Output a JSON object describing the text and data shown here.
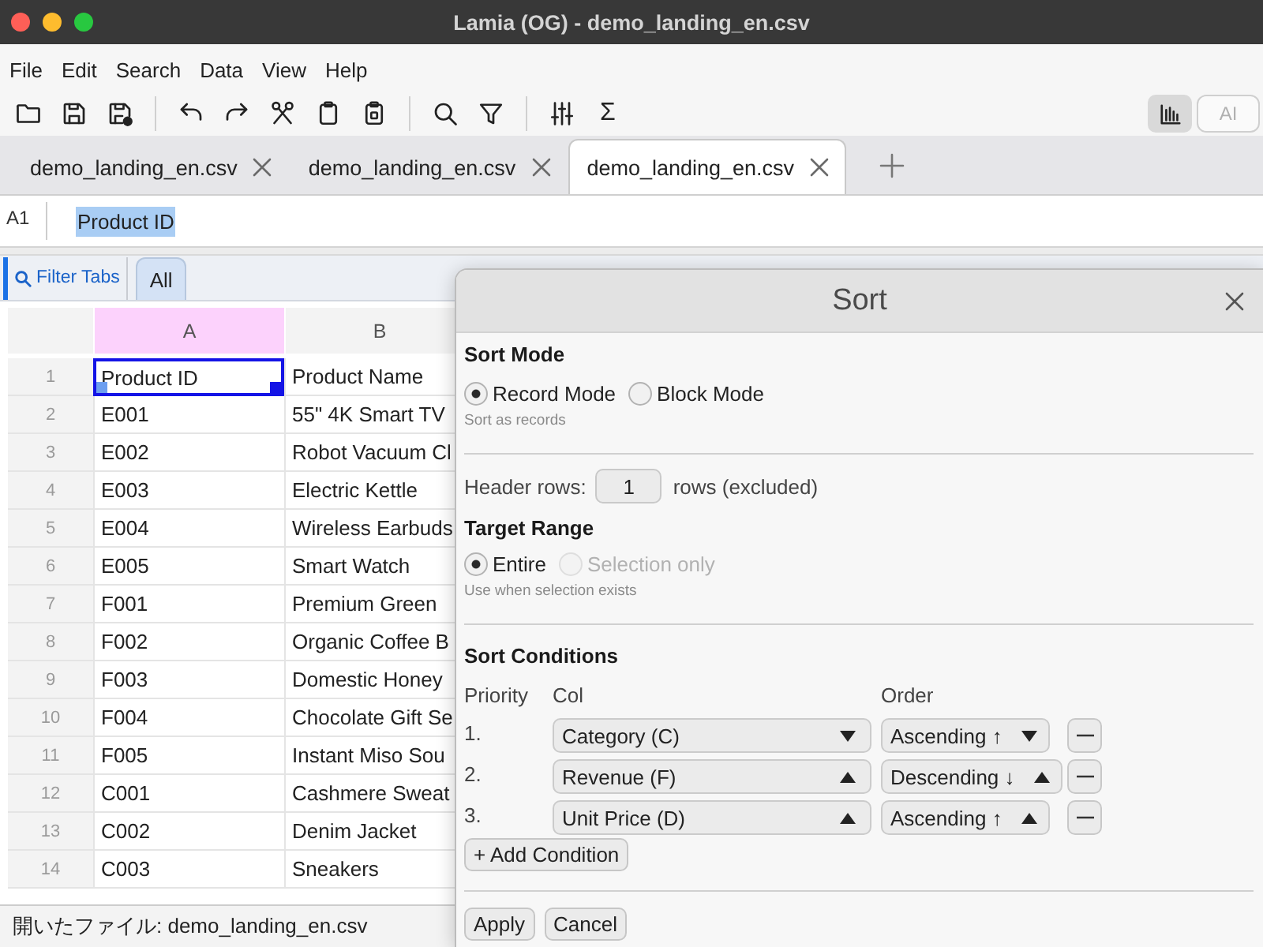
{
  "window": {
    "title": "Lamia (OG) - demo_landing_en.csv"
  },
  "menu": [
    "File",
    "Edit",
    "Search",
    "Data",
    "View",
    "Help"
  ],
  "toolbar": {
    "sum": "Σ",
    "chart_toggle": {
      "on": true
    },
    "ai_button": {
      "label": "AI",
      "disabled": true
    }
  },
  "tabs": [
    {
      "label": "demo_landing_en.csv",
      "selected": false
    },
    {
      "label": "demo_landing_en.csv",
      "selected": false
    },
    {
      "label": "demo_landing_en.csv",
      "selected": true
    }
  ],
  "formula_bar": {
    "cell_ref": "A1",
    "value": "Product ID",
    "value_selected": true
  },
  "sheet_tabs": {
    "filter": "Filter Tabs",
    "tabs": [
      {
        "label": "All",
        "selected": true
      }
    ]
  },
  "grid": {
    "columns": [
      {
        "label": "A",
        "selected": true
      },
      {
        "label": "B",
        "selected": false
      }
    ],
    "rows": [
      {
        "number": "1",
        "cells": [
          {
            "text": "Product ID",
            "selected": true
          },
          {
            "text": "Product Name",
            "selected": false
          }
        ]
      },
      {
        "number": "2",
        "cells": [
          {
            "text": "E001",
            "selected": false
          },
          {
            "text": "55\" 4K Smart TV",
            "selected": false
          }
        ]
      },
      {
        "number": "3",
        "cells": [
          {
            "text": "E002",
            "selected": false
          },
          {
            "text": "Robot Vacuum Cl",
            "selected": false
          }
        ]
      },
      {
        "number": "4",
        "cells": [
          {
            "text": "E003",
            "selected": false
          },
          {
            "text": "Electric Kettle",
            "selected": false
          }
        ]
      },
      {
        "number": "5",
        "cells": [
          {
            "text": "E004",
            "selected": false
          },
          {
            "text": "Wireless Earbuds",
            "selected": false
          }
        ]
      },
      {
        "number": "6",
        "cells": [
          {
            "text": "E005",
            "selected": false
          },
          {
            "text": "Smart Watch",
            "selected": false
          }
        ]
      },
      {
        "number": "7",
        "cells": [
          {
            "text": "F001",
            "selected": false
          },
          {
            "text": "Premium Green",
            "selected": false
          }
        ]
      },
      {
        "number": "8",
        "cells": [
          {
            "text": "F002",
            "selected": false
          },
          {
            "text": "Organic Coffee B",
            "selected": false
          }
        ]
      },
      {
        "number": "9",
        "cells": [
          {
            "text": "F003",
            "selected": false
          },
          {
            "text": "Domestic Honey",
            "selected": false
          }
        ]
      },
      {
        "number": "10",
        "cells": [
          {
            "text": "F004",
            "selected": false
          },
          {
            "text": "Chocolate Gift Se",
            "selected": false
          }
        ]
      },
      {
        "number": "11",
        "cells": [
          {
            "text": "F005",
            "selected": false
          },
          {
            "text": "Instant Miso Sou",
            "selected": false
          }
        ]
      },
      {
        "number": "12",
        "cells": [
          {
            "text": "C001",
            "selected": false
          },
          {
            "text": "Cashmere Sweat",
            "selected": false
          }
        ]
      },
      {
        "number": "13",
        "cells": [
          {
            "text": "C002",
            "selected": false
          },
          {
            "text": "Denim Jacket",
            "selected": false
          }
        ]
      },
      {
        "number": "14",
        "cells": [
          {
            "text": "C003",
            "selected": false
          },
          {
            "text": "Sneakers",
            "selected": false
          }
        ]
      }
    ]
  },
  "status_bar": "開いたファイル: demo_landing_en.csv",
  "dialog": {
    "title": "Sort",
    "sort_mode": {
      "label": "Sort Mode",
      "options": [
        {
          "label": "Record Mode",
          "selected": true,
          "disabled": false
        },
        {
          "label": "Block Mode",
          "selected": false,
          "disabled": false
        }
      ],
      "hint": "Sort as records"
    },
    "header_rows": {
      "label": "Header rows:",
      "value": "1",
      "suffix": "rows (excluded)"
    },
    "target_range": {
      "label": "Target Range",
      "options": [
        {
          "label": "Entire",
          "selected": true,
          "disabled": false
        },
        {
          "label": "Selection only",
          "selected": false,
          "disabled": true
        }
      ],
      "hint": "Use when selection exists"
    },
    "conditions": {
      "label": "Sort Conditions",
      "headers": [
        "Priority",
        "Col",
        "Order"
      ],
      "rows": [
        {
          "priority": "1.",
          "column": "Category (C)",
          "column_caret_up": false,
          "order": "Ascending ↑",
          "order_caret_up": false
        },
        {
          "priority": "2.",
          "column": "Revenue (F)",
          "column_caret_up": true,
          "order": "Descending ↓",
          "order_caret_up": true
        },
        {
          "priority": "3.",
          "column": "Unit Price (D)",
          "column_caret_up": true,
          "order": "Ascending ↑",
          "order_caret_up": true
        }
      ],
      "add_button": "+ Add Condition"
    },
    "buttons": [
      "Apply",
      "Cancel"
    ]
  }
}
